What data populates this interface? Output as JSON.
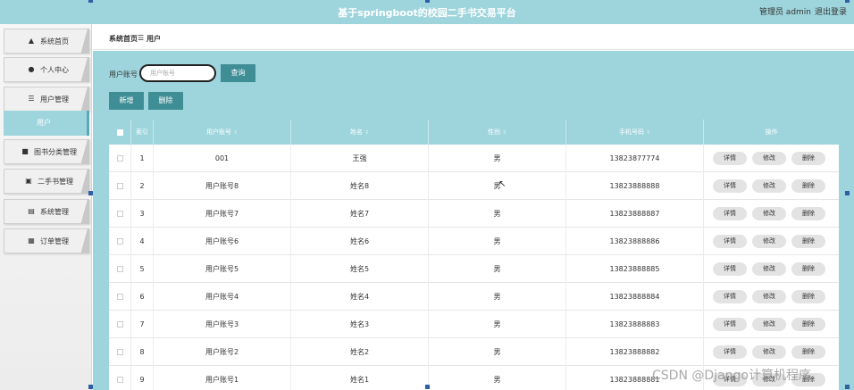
{
  "header": {
    "title": "基于springboot的校园二手书交易平台",
    "admin_label": "管理员 admin",
    "logout_label": "退出登录"
  },
  "sidebar": {
    "items": [
      {
        "label": "系统首页",
        "icon": "home-icon"
      },
      {
        "label": "个人中心",
        "icon": "user-icon"
      },
      {
        "label": "用户管理",
        "icon": "list-icon"
      },
      {
        "label": "图书分类管理",
        "icon": "briefcase-icon"
      },
      {
        "label": "二手书管理",
        "icon": "clipboard-icon"
      },
      {
        "label": "系统管理",
        "icon": "file-icon"
      },
      {
        "label": "订单管理",
        "icon": "grid-icon"
      }
    ],
    "active_sub": "用户"
  },
  "breadcrumb": {
    "home": "系统首页",
    "separator": "☰",
    "current": "用户"
  },
  "search": {
    "label": "用户账号",
    "placeholder": "用户账号",
    "button": "查询"
  },
  "actions": {
    "add": "新增",
    "delete": "删除"
  },
  "table": {
    "headers": [
      "索引",
      "用户账号",
      "姓名",
      "性别",
      "手机号码",
      "操作"
    ],
    "rows": [
      {
        "index": "1",
        "account": "001",
        "name": "王强",
        "gender": "男",
        "phone": "13823877774"
      },
      {
        "index": "2",
        "account": "用户账号8",
        "name": "姓名8",
        "gender": "男",
        "phone": "13823888888"
      },
      {
        "index": "3",
        "account": "用户账号7",
        "name": "姓名7",
        "gender": "男",
        "phone": "13823888887"
      },
      {
        "index": "4",
        "account": "用户账号6",
        "name": "姓名6",
        "gender": "男",
        "phone": "13823888886"
      },
      {
        "index": "5",
        "account": "用户账号5",
        "name": "姓名5",
        "gender": "男",
        "phone": "13823888885"
      },
      {
        "index": "6",
        "account": "用户账号4",
        "name": "姓名4",
        "gender": "男",
        "phone": "13823888884"
      },
      {
        "index": "7",
        "account": "用户账号3",
        "name": "姓名3",
        "gender": "男",
        "phone": "13823888883"
      },
      {
        "index": "8",
        "account": "用户账号2",
        "name": "姓名2",
        "gender": "男",
        "phone": "13823888882"
      },
      {
        "index": "9",
        "account": "用户账号1",
        "name": "姓名1",
        "gender": "男",
        "phone": "13823888881"
      }
    ],
    "row_actions": {
      "detail": "详情",
      "edit": "修改",
      "delete": "删除"
    }
  },
  "watermark": "CSDN @Django计算机程序",
  "colors": {
    "accent": "#9ed5dd",
    "button": "#3f8e96"
  }
}
